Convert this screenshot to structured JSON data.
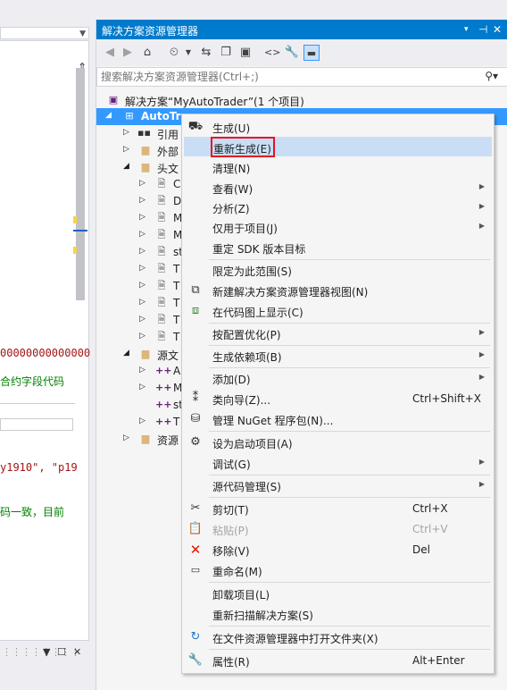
{
  "left_panel": {
    "code_lines": [
      "00000000000000",
      "合约字段代码",
      "y1910\", \"p19",
      "码一致，目前"
    ]
  },
  "solution_explorer": {
    "title": "解决方案资源管理器",
    "title_controls": [
      "▾",
      "⊣",
      "✕"
    ],
    "search_placeholder": "搜索解决方案资源管理器(Ctrl+;)",
    "tree": [
      {
        "label": "解决方案“MyAutoTrader”(1 个项目)"
      },
      {
        "label": "AutoTra"
      },
      {
        "label": "引用"
      },
      {
        "label": "外部"
      },
      {
        "label": "头文"
      },
      {
        "label": "C"
      },
      {
        "label": "D"
      },
      {
        "label": "M"
      },
      {
        "label": "M"
      },
      {
        "label": "st"
      },
      {
        "label": "T"
      },
      {
        "label": "T"
      },
      {
        "label": "T"
      },
      {
        "label": "T"
      },
      {
        "label": "T"
      },
      {
        "label": "源文"
      },
      {
        "label": "A"
      },
      {
        "label": "M"
      },
      {
        "label": "st"
      },
      {
        "label": "T"
      },
      {
        "label": "资源"
      }
    ]
  },
  "context_menu": {
    "items": [
      {
        "label": "生成(U)",
        "shortcut": "",
        "icon": "build-icon"
      },
      {
        "label": "重新生成(E)",
        "shortcut": "",
        "icon": ""
      },
      {
        "label": "清理(N)",
        "shortcut": "",
        "icon": ""
      },
      {
        "label": "查看(W)",
        "shortcut": "",
        "icon": ""
      },
      {
        "label": "分析(Z)",
        "shortcut": "",
        "icon": ""
      },
      {
        "label": "仅用于项目(J)",
        "shortcut": "",
        "icon": ""
      },
      {
        "label": "重定 SDK 版本目标",
        "shortcut": "",
        "icon": ""
      },
      {
        "label": "限定为此范围(S)",
        "shortcut": "",
        "icon": ""
      },
      {
        "label": "新建解决方案资源管理器视图(N)",
        "shortcut": "",
        "icon": "new-view-icon"
      },
      {
        "label": "在代码图上显示(C)",
        "shortcut": "",
        "icon": "code-map-icon"
      },
      {
        "label": "按配置优化(P)",
        "shortcut": "",
        "icon": ""
      },
      {
        "label": "生成依赖项(B)",
        "shortcut": "",
        "icon": ""
      },
      {
        "label": "添加(D)",
        "shortcut": "",
        "icon": ""
      },
      {
        "label": "类向导(Z)...",
        "shortcut": "Ctrl+Shift+X",
        "icon": "class-wizard-icon"
      },
      {
        "label": "管理 NuGet 程序包(N)...",
        "shortcut": "",
        "icon": "nuget-icon"
      },
      {
        "label": "设为启动项目(A)",
        "shortcut": "",
        "icon": "gear-icon"
      },
      {
        "label": "调试(G)",
        "shortcut": "",
        "icon": ""
      },
      {
        "label": "源代码管理(S)",
        "shortcut": "",
        "icon": ""
      },
      {
        "label": "剪切(T)",
        "shortcut": "Ctrl+X",
        "icon": "cut-icon"
      },
      {
        "label": "粘贴(P)",
        "shortcut": "Ctrl+V",
        "icon": "paste-icon"
      },
      {
        "label": "移除(V)",
        "shortcut": "Del",
        "icon": "remove-icon"
      },
      {
        "label": "重命名(M)",
        "shortcut": "",
        "icon": "rename-icon"
      },
      {
        "label": "卸载项目(L)",
        "shortcut": "",
        "icon": ""
      },
      {
        "label": "重新扫描解决方案(S)",
        "shortcut": "",
        "icon": ""
      },
      {
        "label": "在文件资源管理器中打开文件夹(X)",
        "shortcut": "",
        "icon": "open-folder-icon"
      },
      {
        "label": "属性(R)",
        "shortcut": "Alt+Enter",
        "icon": "wrench-icon"
      }
    ]
  },
  "colors": {
    "accent": "#007acc",
    "selection": "#3399ff",
    "highlight": "#c9def5",
    "red_outline": "#e81123"
  }
}
